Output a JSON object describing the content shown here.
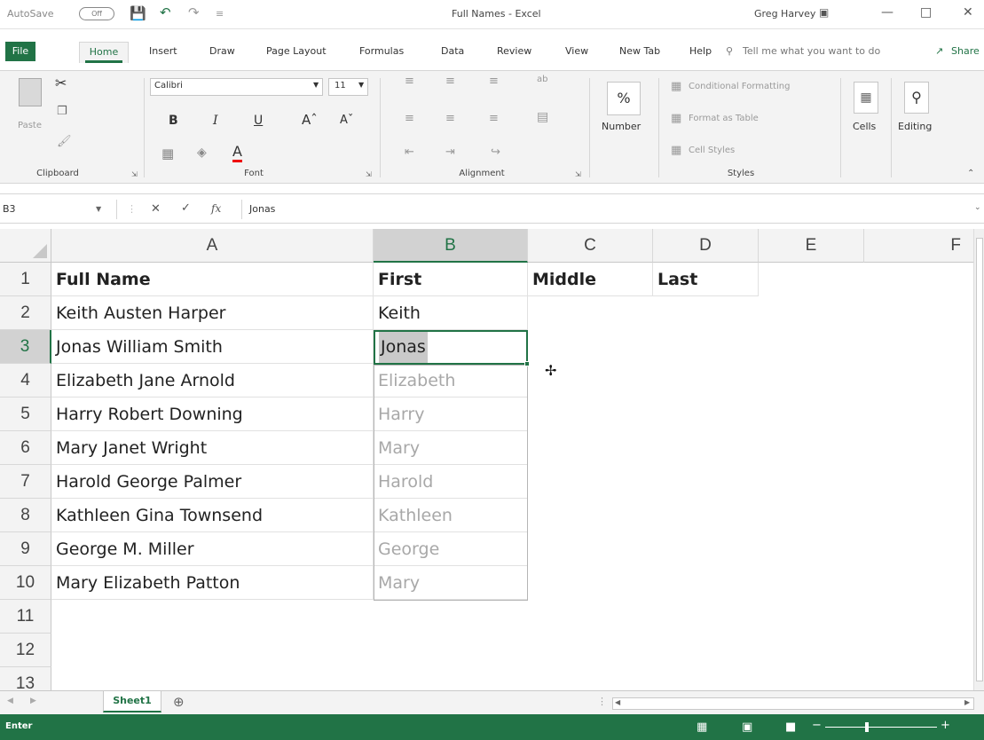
{
  "titlebar": {
    "autosave_label": "AutoSave",
    "autosave_state": "Off",
    "title": "Full Names - Excel",
    "user": "Greg Harvey"
  },
  "ribbon_tabs": [
    "File",
    "Home",
    "Insert",
    "Draw",
    "Page Layout",
    "Formulas",
    "Data",
    "Review",
    "View",
    "New Tab",
    "Help"
  ],
  "tell_me": "Tell me what you want to do",
  "share": "Share",
  "ribbon": {
    "clipboard": {
      "label": "Clipboard",
      "paste": "Paste"
    },
    "font": {
      "label": "Font",
      "name": "Calibri",
      "size": "11"
    },
    "alignment": {
      "label": "Alignment"
    },
    "number": {
      "label": "Number"
    },
    "styles": {
      "label": "Styles",
      "conditional": "Conditional Formatting",
      "format_table": "Format as Table",
      "cell_styles": "Cell Styles"
    },
    "cells": {
      "label": "Cells"
    },
    "editing": {
      "label": "Editing"
    }
  },
  "formula_bar": {
    "name_box": "B3",
    "value": "Jonas"
  },
  "grid": {
    "columns": [
      "A",
      "B",
      "C",
      "D",
      "E",
      "F"
    ],
    "rows": [
      "1",
      "2",
      "3",
      "4",
      "5",
      "6",
      "7",
      "8",
      "9",
      "10",
      "11",
      "12",
      "13"
    ],
    "cells": [
      [
        "Full Name",
        "First",
        "Middle",
        "Last"
      ],
      [
        "Keith Austen Harper",
        "Keith"
      ],
      [
        "Jonas William Smith",
        "Jonas"
      ],
      [
        "Elizabeth Jane Arnold",
        "Elizabeth"
      ],
      [
        "Harry Robert Downing",
        "Harry"
      ],
      [
        "Mary Janet Wright",
        "Mary"
      ],
      [
        "Harold George Palmer",
        "Harold"
      ],
      [
        "Kathleen Gina Townsend",
        "Kathleen"
      ],
      [
        "George M. Miller",
        "George"
      ],
      [
        "Mary Elizabeth Patton",
        "Mary"
      ]
    ],
    "selected_column": "B",
    "selected_row": "3"
  },
  "sheet_tab": "Sheet1",
  "status": {
    "mode": "Enter"
  },
  "colors": {
    "excel_green": "#217346"
  }
}
